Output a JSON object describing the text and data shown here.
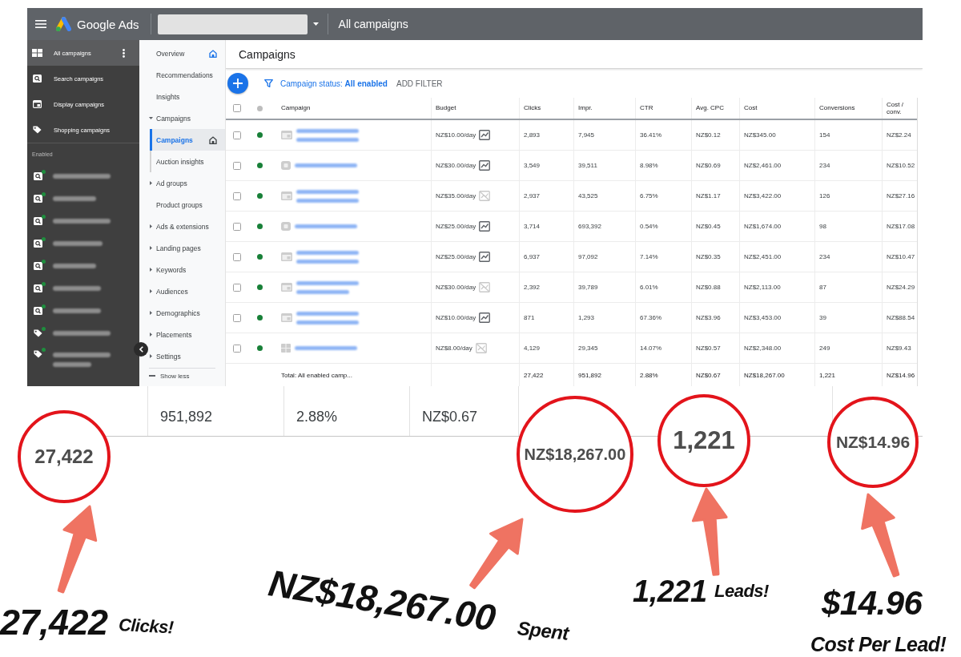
{
  "topbar": {
    "app_name": "Google Ads",
    "breadcrumb": "All campaigns"
  },
  "sidebar": {
    "items": [
      {
        "label": "All campaigns",
        "kind": "all",
        "selected": true
      },
      {
        "label": "Search campaigns",
        "kind": "search",
        "selected": false
      },
      {
        "label": "Display campaigns",
        "kind": "display",
        "selected": false
      },
      {
        "label": "Shopping campaigns",
        "kind": "shopping",
        "selected": false
      }
    ],
    "section_label": "Enabled",
    "campaigns": [
      {
        "kind": "search",
        "enabled": true,
        "wrapped": false
      },
      {
        "kind": "search",
        "enabled": true,
        "wrapped": false
      },
      {
        "kind": "search",
        "enabled": true,
        "wrapped": false
      },
      {
        "kind": "search",
        "enabled": true,
        "wrapped": false
      },
      {
        "kind": "search",
        "enabled": true,
        "wrapped": false
      },
      {
        "kind": "search",
        "enabled": true,
        "wrapped": false
      },
      {
        "kind": "search",
        "enabled": true,
        "wrapped": false
      },
      {
        "kind": "shopping",
        "enabled": true,
        "wrapped": false
      },
      {
        "kind": "shopping",
        "enabled": true,
        "wrapped": true
      }
    ]
  },
  "nav": {
    "items": [
      {
        "label": "Overview",
        "kind": "link",
        "selected": false,
        "home": true
      },
      {
        "label": "Recommendations",
        "kind": "link",
        "selected": false,
        "home": false
      },
      {
        "label": "Insights",
        "kind": "link",
        "selected": false,
        "home": false
      },
      {
        "label": "Campaigns",
        "kind": "group",
        "expanded": true,
        "selected": false,
        "home": false
      },
      {
        "label": "Campaigns",
        "kind": "subitem",
        "selected": true,
        "home": true
      },
      {
        "label": "Auction insights",
        "kind": "subitem",
        "selected": false,
        "home": false
      },
      {
        "label": "Ad groups",
        "kind": "group",
        "expanded": false,
        "selected": false,
        "home": false
      },
      {
        "label": "Product groups",
        "kind": "link",
        "selected": false,
        "home": false
      },
      {
        "label": "Ads & extensions",
        "kind": "group",
        "expanded": false,
        "selected": false,
        "home": false
      },
      {
        "label": "Landing pages",
        "kind": "group",
        "expanded": false,
        "selected": false,
        "home": false
      },
      {
        "label": "Keywords",
        "kind": "group",
        "expanded": false,
        "selected": false,
        "home": false
      },
      {
        "label": "Audiences",
        "kind": "group",
        "expanded": false,
        "selected": false,
        "home": false
      },
      {
        "label": "Demographics",
        "kind": "group",
        "expanded": false,
        "selected": false,
        "home": false
      },
      {
        "label": "Placements",
        "kind": "group",
        "expanded": false,
        "selected": false,
        "home": false
      },
      {
        "label": "Settings",
        "kind": "group",
        "expanded": false,
        "selected": false,
        "home": false
      }
    ],
    "show_less": "Show less"
  },
  "page": {
    "title": "Campaigns",
    "filter": "Campaign status: **All enabled**",
    "add_filter": "ADD FILTER"
  },
  "table": {
    "columns": [
      "Campaign",
      "Budget",
      "Clicks",
      "Impr.",
      "CTR",
      "Avg. CPC",
      "Cost",
      "Conversions",
      "Cost / conv."
    ],
    "all_checked": false,
    "rows": [
      {
        "kind": "display",
        "checked": false,
        "enabled": true,
        "budget": "NZ$10.00/day",
        "graph_disabled": false,
        "values": [
          "2,893",
          "7,945",
          "36.41%",
          "NZ$0.12",
          "NZ$345.00",
          "154",
          "NZ$2.24"
        ]
      },
      {
        "kind": "video",
        "checked": false,
        "enabled": true,
        "budget": "NZ$30.00/day",
        "graph_disabled": false,
        "values": [
          "3,549",
          "39,511",
          "8.98%",
          "NZ$0.69",
          "NZ$2,461.00",
          "234",
          "NZ$10.52"
        ]
      },
      {
        "kind": "display",
        "checked": false,
        "enabled": true,
        "budget": "NZ$35.00/day",
        "graph_disabled": true,
        "values": [
          "2,937",
          "43,525",
          "6.75%",
          "NZ$1.17",
          "NZ$3,422.00",
          "126",
          "NZ$27.16"
        ]
      },
      {
        "kind": "video",
        "checked": false,
        "enabled": true,
        "budget": "NZ$25.00/day",
        "graph_disabled": false,
        "values": [
          "3,714",
          "693,392",
          "0.54%",
          "NZ$0.45",
          "NZ$1,674.00",
          "98",
          "NZ$17.08"
        ]
      },
      {
        "kind": "display",
        "checked": false,
        "enabled": true,
        "budget": "NZ$25.00/day",
        "graph_disabled": false,
        "values": [
          "6,937",
          "97,092",
          "7.14%",
          "NZ$0.35",
          "NZ$2,451.00",
          "234",
          "NZ$10.47"
        ]
      },
      {
        "kind": "display",
        "checked": false,
        "enabled": true,
        "budget": "NZ$30.00/day",
        "graph_disabled": true,
        "values": [
          "2,392",
          "39,789",
          "6.01%",
          "NZ$0.88",
          "NZ$2,113.00",
          "87",
          "NZ$24.29"
        ]
      },
      {
        "kind": "display",
        "checked": false,
        "enabled": true,
        "budget": "NZ$10.00/day",
        "graph_disabled": false,
        "values": [
          "871",
          "1,293",
          "67.36%",
          "NZ$3.96",
          "NZ$3,453.00",
          "39",
          "NZ$88.54"
        ]
      },
      {
        "kind": "shopping",
        "checked": false,
        "enabled": true,
        "budget": "NZ$8.00/day",
        "graph_disabled": true,
        "values": [
          "4,129",
          "29,345",
          "14.07%",
          "NZ$0.57",
          "NZ$2,348.00",
          "249",
          "NZ$9.43"
        ]
      }
    ],
    "total": {
      "label": "Total: All enabled camp...",
      "values": [
        "27,422",
        "951,892",
        "2.88%",
        "NZ$0.67",
        "NZ$18,267.00",
        "1,221",
        "NZ$14.96"
      ]
    }
  },
  "zoom_strip": {
    "cells": [
      "951,892",
      "2.88%",
      "NZ$0.67"
    ]
  },
  "callouts": [
    {
      "circled": "27,422",
      "amount": "27,422",
      "caption": "Clicks!"
    },
    {
      "circled": "NZ$18,267.00",
      "amount": "NZ$18,267.00",
      "caption": "Spent"
    },
    {
      "circled": "1,221",
      "amount": "1,221",
      "caption": "Leads!"
    },
    {
      "circled": "NZ$14.96",
      "amount": "$14.96",
      "caption": "Cost Per Lead!"
    }
  ]
}
